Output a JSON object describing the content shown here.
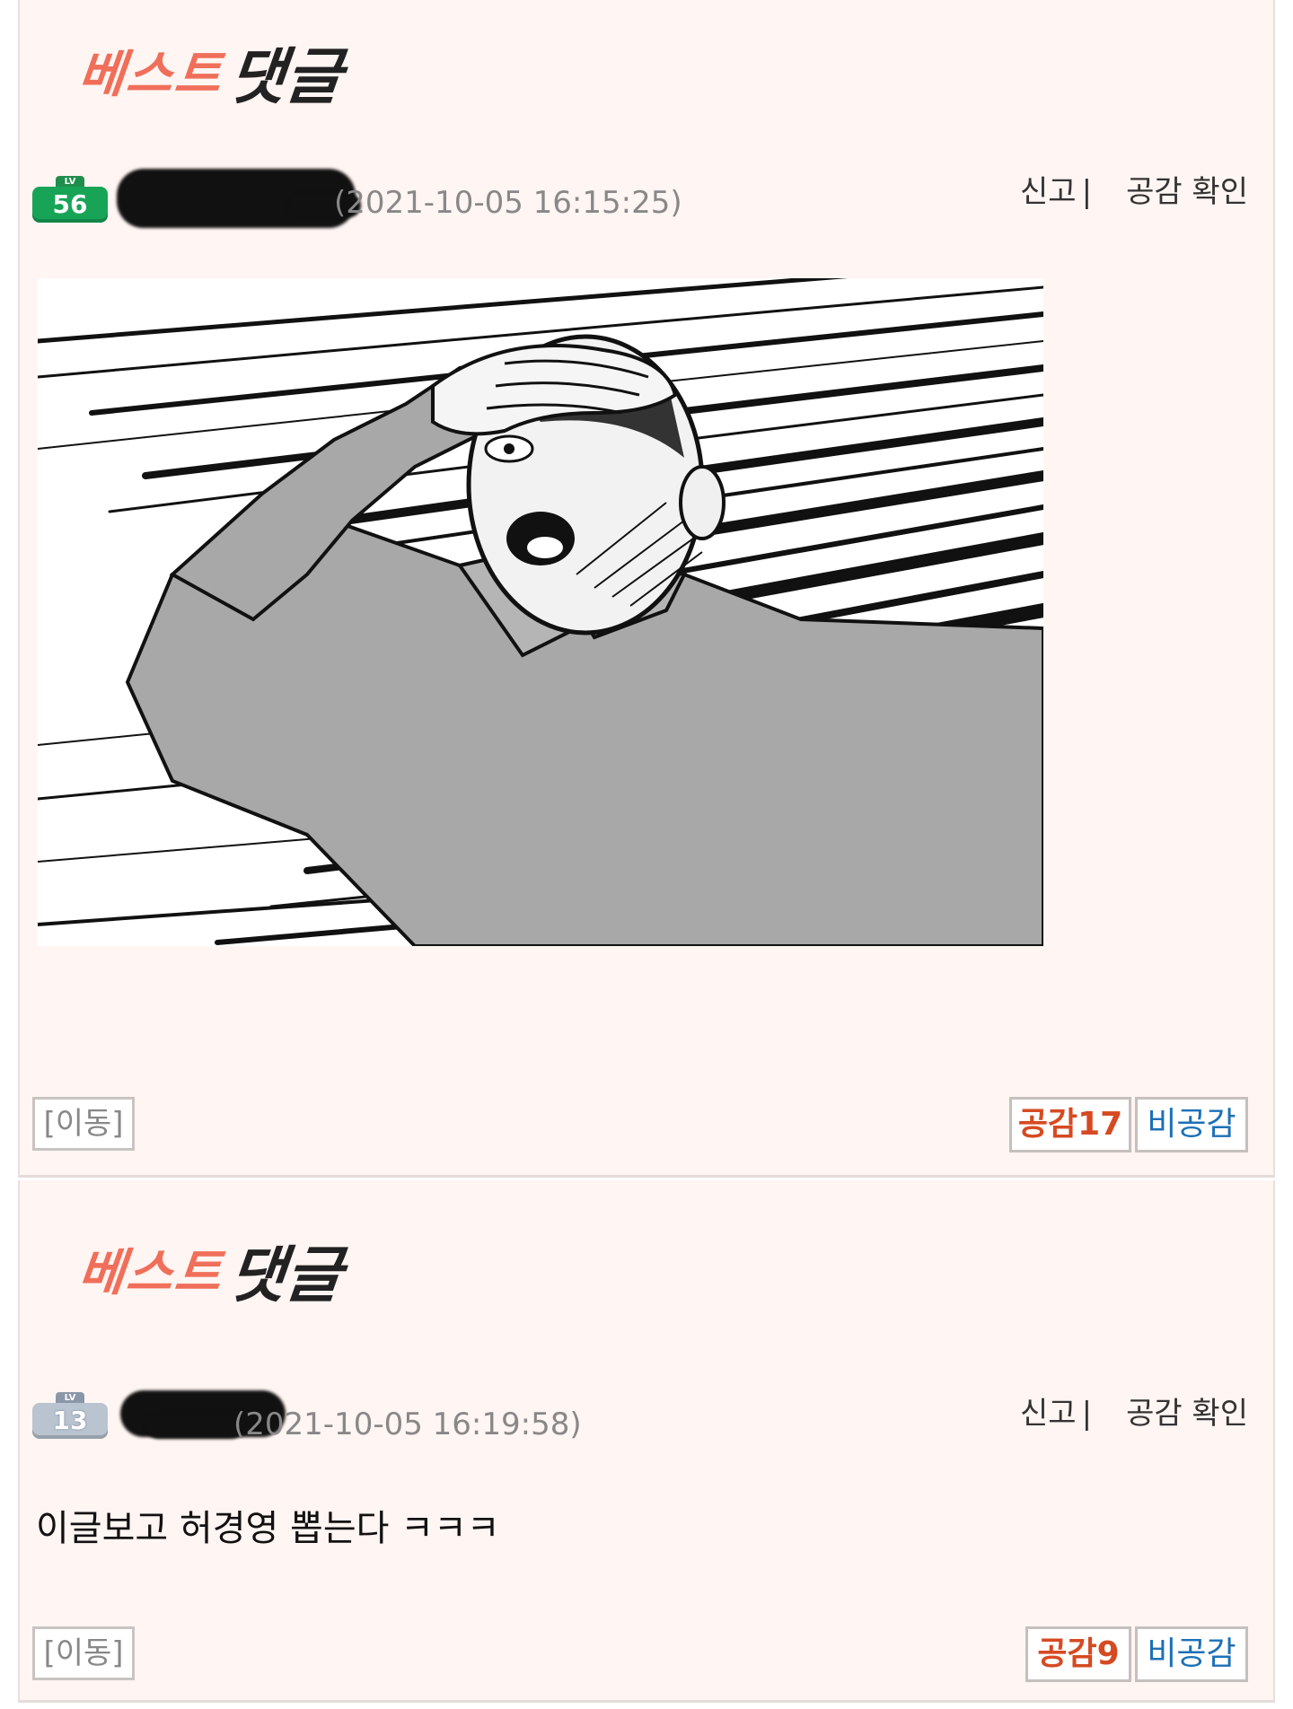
{
  "comments": [
    {
      "badge_red": "베스트",
      "badge_black": "댓글",
      "level_tab": "LV",
      "level": "56",
      "timestamp": "(2021-10-05 16:15:25)",
      "report_label": "신고",
      "separator": "|",
      "check_likes_label": "공감 확인",
      "move_label": "[이동]",
      "like_label": "공감",
      "like_count": "17",
      "dislike_label": "비공감"
    },
    {
      "badge_red": "베스트",
      "badge_black": "댓글",
      "level_tab": "LV",
      "level": "13",
      "timestamp": "(2021-10-05 16:19:58)",
      "report_label": "신고",
      "separator": "|",
      "check_likes_label": "공감 확인",
      "text": "이글보고 허경영 뽑는다 ㅋㅋㅋ",
      "move_label": "[이동]",
      "like_label": "공감",
      "like_count": "9",
      "dislike_label": "비공감"
    }
  ],
  "colors": {
    "background": "#fff5f2",
    "badge_red": "#f06f5a",
    "like_red": "#d64a22",
    "dislike_blue": "#1c70b7",
    "level_green": "#18a457",
    "level_grey": "#b9c4d0"
  }
}
